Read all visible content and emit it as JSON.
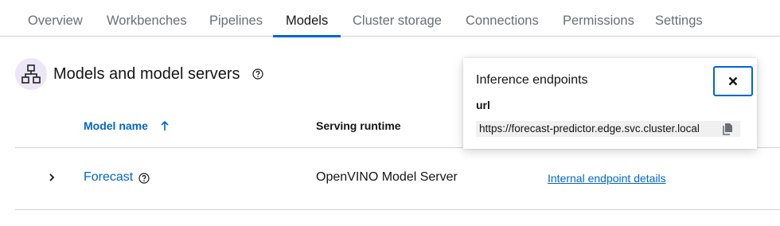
{
  "tabs": [
    {
      "label": "Overview",
      "active": false
    },
    {
      "label": "Workbenches",
      "active": false
    },
    {
      "label": "Pipelines",
      "active": false
    },
    {
      "label": "Models",
      "active": true
    },
    {
      "label": "Cluster storage",
      "active": false
    },
    {
      "label": "Connections",
      "active": false
    },
    {
      "label": "Permissions",
      "active": false
    },
    {
      "label": "Settings",
      "active": false
    }
  ],
  "section": {
    "icon": "model-server-icon",
    "title": "Models and model servers",
    "help_icon": "help-circle-icon"
  },
  "table": {
    "columns": {
      "model_name": "Model name",
      "serving_runtime": "Serving runtime"
    },
    "sort_icon": "arrow-up-icon",
    "rows": [
      {
        "expand_icon": "chevron-right-icon",
        "model_name": "Forecast",
        "help_icon": "help-circle-icon",
        "serving_runtime": "OpenVINO Model Server",
        "endpoint_link": "Internal endpoint details"
      }
    ]
  },
  "popover": {
    "title": "Inference endpoints",
    "close_icon": "close-icon",
    "label": "url",
    "url": "https://forecast-predictor.edge.svc.cluster.local",
    "copy_icon": "copy-icon"
  },
  "colors": {
    "accent": "#0066cc",
    "icon_background": "#ece6f6"
  }
}
